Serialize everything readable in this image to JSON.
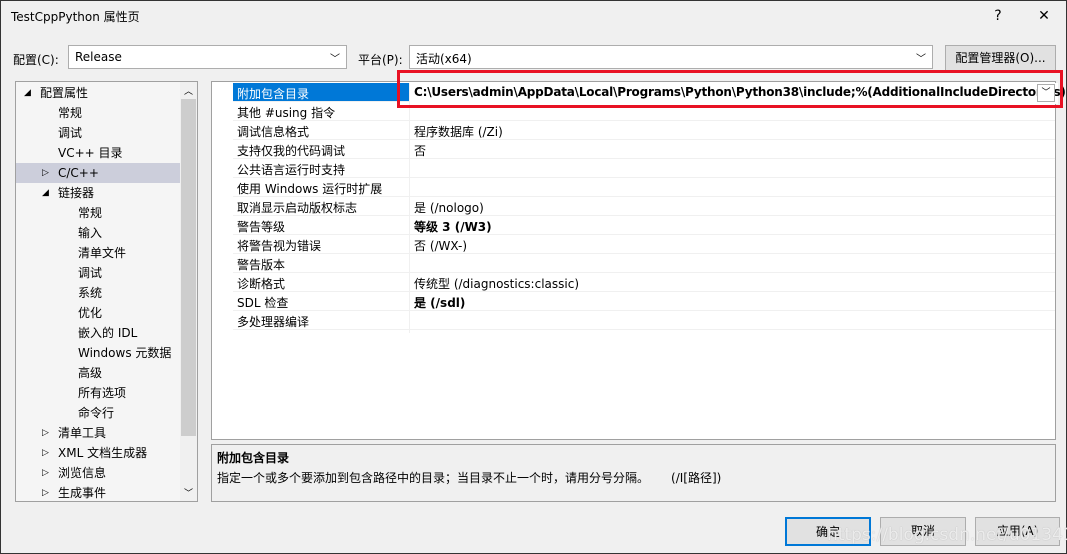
{
  "window": {
    "title": "TestCppPython 属性页",
    "help": "?",
    "close": "✕"
  },
  "config": {
    "label": "配置(C):",
    "value": "Release",
    "platform_label": "平台(P):",
    "platform_value": "活动(x64)",
    "manager_button": "配置管理器(O)..."
  },
  "tree": [
    {
      "label": "配置属性",
      "level": 0,
      "state": "expanded"
    },
    {
      "label": "常规",
      "level": 1
    },
    {
      "label": "调试",
      "level": 1
    },
    {
      "label": "VC++ 目录",
      "level": 1
    },
    {
      "label": "C/C++",
      "level": 1,
      "state": "collapsed",
      "selected": true
    },
    {
      "label": "链接器",
      "level": 1,
      "state": "expanded"
    },
    {
      "label": "常规",
      "level": 2
    },
    {
      "label": "输入",
      "level": 2
    },
    {
      "label": "清单文件",
      "level": 2
    },
    {
      "label": "调试",
      "level": 2
    },
    {
      "label": "系统",
      "level": 2
    },
    {
      "label": "优化",
      "level": 2
    },
    {
      "label": "嵌入的 IDL",
      "level": 2
    },
    {
      "label": "Windows 元数据",
      "level": 2
    },
    {
      "label": "高级",
      "level": 2
    },
    {
      "label": "所有选项",
      "level": 2
    },
    {
      "label": "命令行",
      "level": 2
    },
    {
      "label": "清单工具",
      "level": 1,
      "state": "collapsed"
    },
    {
      "label": "XML 文档生成器",
      "level": 1,
      "state": "collapsed"
    },
    {
      "label": "浏览信息",
      "level": 1,
      "state": "collapsed"
    },
    {
      "label": "生成事件",
      "level": 1,
      "state": "collapsed"
    }
  ],
  "properties": [
    {
      "name": "附加包含目录",
      "value": "C:\\Users\\admin\\AppData\\Local\\Programs\\Python\\Python38\\include;%(AdditionalIncludeDirectories)",
      "bold": true,
      "selected": true
    },
    {
      "name": "其他 #using 指令",
      "value": ""
    },
    {
      "name": "调试信息格式",
      "value": "程序数据库 (/Zi)"
    },
    {
      "name": "支持仅我的代码调试",
      "value": "否"
    },
    {
      "name": "公共语言运行时支持",
      "value": ""
    },
    {
      "name": "使用 Windows 运行时扩展",
      "value": ""
    },
    {
      "name": "取消显示启动版权标志",
      "value": "是 (/nologo)"
    },
    {
      "name": "警告等级",
      "value": "等级 3 (/W3)",
      "bold": true
    },
    {
      "name": "将警告视为错误",
      "value": "否 (/WX-)"
    },
    {
      "name": "警告版本",
      "value": ""
    },
    {
      "name": "诊断格式",
      "value": "传统型 (/diagnostics:classic)"
    },
    {
      "name": "SDL 检查",
      "value": "是 (/sdl)",
      "bold": true
    },
    {
      "name": "多处理器编译",
      "value": ""
    }
  ],
  "description": {
    "title": "附加包含目录",
    "text": "指定一个或多个要添加到包含路径中的目录；当目录不止一个时，请用分号分隔。",
    "switch": "(/I[路径])"
  },
  "buttons": {
    "ok": "确定",
    "cancel": "取消",
    "apply": "应用(A)"
  },
  "watermark": "https://blog.csdn.net/u013412391",
  "colors": {
    "selection": "#0078d7",
    "highlight_box": "#e81123"
  }
}
